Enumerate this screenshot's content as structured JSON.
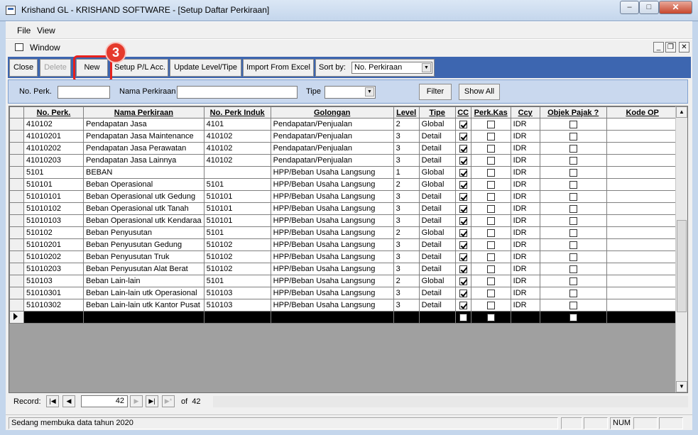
{
  "window": {
    "title": "Krishand GL - KRISHAND SOFTWARE - [Setup Daftar Perkiraan]",
    "min": "–",
    "max": "□",
    "close": "✕"
  },
  "menu": {
    "file": "File",
    "view": "View",
    "window": "Window"
  },
  "mdi": {
    "min": "_",
    "restore": "❐",
    "close": "✕"
  },
  "toolbar": {
    "close": "Close",
    "delete": "Delete",
    "new": "New",
    "setup_pl": "Setup P/L Acc.",
    "update_level": "Update Level/Tipe",
    "import_excel": "Import From Excel",
    "sort_label": "Sort by:",
    "sort_value": "No. Perkiraan"
  },
  "annotation": {
    "step": "3"
  },
  "filter": {
    "no_perk_label": "No. Perk.",
    "no_perk_value": "",
    "nama_label": "Nama Perkiraan",
    "nama_value": "",
    "tipe_label": "Tipe",
    "tipe_value": "",
    "filter_btn": "Filter",
    "show_all_btn": "Show All"
  },
  "grid": {
    "columns": [
      "No. Perk.",
      "Nama Perkiraan",
      "No. Perk Induk",
      "Golongan",
      "Level",
      "Tipe",
      "CC",
      "Perk.Kas",
      "Ccy",
      "Objek Pajak ?",
      "Kode OP"
    ],
    "rows": [
      {
        "no": "410102",
        "nama": "Pendapatan Jasa",
        "induk": "4101",
        "gol": "Pendapatan/Penjualan",
        "level": "2",
        "tipe": "Global",
        "cc": true,
        "kas": false,
        "ccy": "IDR",
        "pajak": false,
        "kode": ""
      },
      {
        "no": "41010201",
        "nama": "Pendapatan Jasa Maintenance",
        "induk": "410102",
        "gol": "Pendapatan/Penjualan",
        "level": "3",
        "tipe": "Detail",
        "cc": true,
        "kas": false,
        "ccy": "IDR",
        "pajak": false,
        "kode": ""
      },
      {
        "no": "41010202",
        "nama": "Pendapatan Jasa Perawatan",
        "induk": "410102",
        "gol": "Pendapatan/Penjualan",
        "level": "3",
        "tipe": "Detail",
        "cc": true,
        "kas": false,
        "ccy": "IDR",
        "pajak": false,
        "kode": ""
      },
      {
        "no": "41010203",
        "nama": "Pendapatan Jasa Lainnya",
        "induk": "410102",
        "gol": "Pendapatan/Penjualan",
        "level": "3",
        "tipe": "Detail",
        "cc": true,
        "kas": false,
        "ccy": "IDR",
        "pajak": false,
        "kode": ""
      },
      {
        "no": "5101",
        "nama": "BEBAN",
        "induk": "",
        "gol": "HPP/Beban Usaha Langsung",
        "level": "1",
        "tipe": "Global",
        "cc": true,
        "kas": false,
        "ccy": "IDR",
        "pajak": false,
        "kode": ""
      },
      {
        "no": "510101",
        "nama": "Beban Operasional",
        "induk": "5101",
        "gol": "HPP/Beban Usaha Langsung",
        "level": "2",
        "tipe": "Global",
        "cc": true,
        "kas": false,
        "ccy": "IDR",
        "pajak": false,
        "kode": ""
      },
      {
        "no": "51010101",
        "nama": "Beban Operasional utk Gedung",
        "induk": "510101",
        "gol": "HPP/Beban Usaha Langsung",
        "level": "3",
        "tipe": "Detail",
        "cc": true,
        "kas": false,
        "ccy": "IDR",
        "pajak": false,
        "kode": ""
      },
      {
        "no": "51010102",
        "nama": "Beban Operasional utk Tanah",
        "induk": "510101",
        "gol": "HPP/Beban Usaha Langsung",
        "level": "3",
        "tipe": "Detail",
        "cc": true,
        "kas": false,
        "ccy": "IDR",
        "pajak": false,
        "kode": ""
      },
      {
        "no": "51010103",
        "nama": "Beban Operasional utk Kendaraa",
        "induk": "510101",
        "gol": "HPP/Beban Usaha Langsung",
        "level": "3",
        "tipe": "Detail",
        "cc": true,
        "kas": false,
        "ccy": "IDR",
        "pajak": false,
        "kode": ""
      },
      {
        "no": "510102",
        "nama": "Beban Penyusutan",
        "induk": "5101",
        "gol": "HPP/Beban Usaha Langsung",
        "level": "2",
        "tipe": "Global",
        "cc": true,
        "kas": false,
        "ccy": "IDR",
        "pajak": false,
        "kode": ""
      },
      {
        "no": "51010201",
        "nama": "Beban Penyusutan Gedung",
        "induk": "510102",
        "gol": "HPP/Beban Usaha Langsung",
        "level": "3",
        "tipe": "Detail",
        "cc": true,
        "kas": false,
        "ccy": "IDR",
        "pajak": false,
        "kode": ""
      },
      {
        "no": "51010202",
        "nama": "Beban Penyusutan Truk",
        "induk": "510102",
        "gol": "HPP/Beban Usaha Langsung",
        "level": "3",
        "tipe": "Detail",
        "cc": true,
        "kas": false,
        "ccy": "IDR",
        "pajak": false,
        "kode": ""
      },
      {
        "no": "51010203",
        "nama": "Beban Penyusutan Alat Berat",
        "induk": "510102",
        "gol": "HPP/Beban Usaha Langsung",
        "level": "3",
        "tipe": "Detail",
        "cc": true,
        "kas": false,
        "ccy": "IDR",
        "pajak": false,
        "kode": ""
      },
      {
        "no": "510103",
        "nama": "Beban Lain-lain",
        "induk": "5101",
        "gol": "HPP/Beban Usaha Langsung",
        "level": "2",
        "tipe": "Global",
        "cc": true,
        "kas": false,
        "ccy": "IDR",
        "pajak": false,
        "kode": ""
      },
      {
        "no": "51010301",
        "nama": "Beban Lain-lain utk Operasional",
        "induk": "510103",
        "gol": "HPP/Beban Usaha Langsung",
        "level": "3",
        "tipe": "Detail",
        "cc": true,
        "kas": false,
        "ccy": "IDR",
        "pajak": false,
        "kode": ""
      },
      {
        "no": "51010302",
        "nama": "Beban Lain-lain utk Kantor Pusat",
        "induk": "510103",
        "gol": "HPP/Beban Usaha Langsung",
        "level": "3",
        "tipe": "Detail",
        "cc": true,
        "kas": false,
        "ccy": "IDR",
        "pajak": false,
        "kode": ""
      }
    ]
  },
  "nav": {
    "record_label": "Record:",
    "current": "42",
    "of_label": "of",
    "total": "42"
  },
  "status": {
    "message": "Sedang membuka data tahun 2020",
    "num": "NUM"
  }
}
